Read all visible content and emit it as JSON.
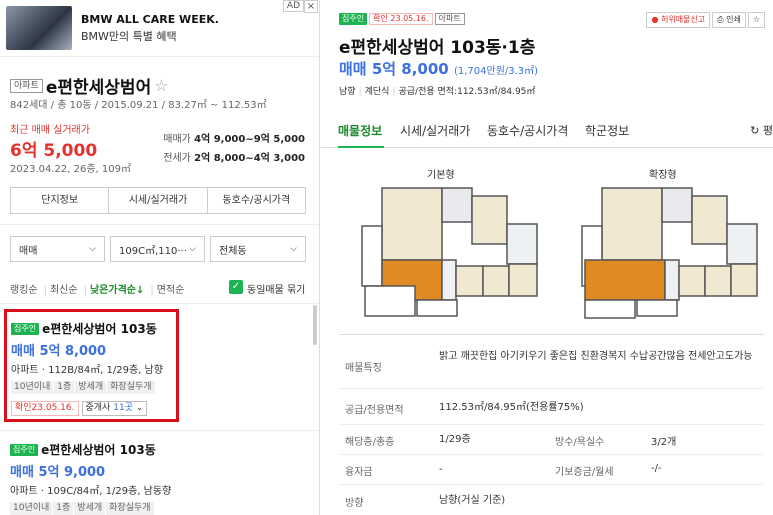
{
  "ad": {
    "title": "BMW ALL CARE WEEK.",
    "subtitle": "BMW만의 특별 혜택",
    "ad_tag": "AD",
    "close": "×"
  },
  "complex": {
    "type_tag": "아파트",
    "name": "e편한세상범어",
    "star": "☆",
    "info": "842세대 / 총 10동 / 2015.09.21 / 83.27㎡ ~ 112.53㎡"
  },
  "recent": {
    "label": "최근 매매 실거래가",
    "price": "6억 5,000",
    "date": "2023.04.22, 26층, 109㎡"
  },
  "price_table": [
    {
      "label": "매매가",
      "value": "4억 9,000~9억 5,000"
    },
    {
      "label": "전세가",
      "value": "2억 8,000~4억 3,000"
    }
  ],
  "left_tabs": [
    "단지정보",
    "시세/실거래가",
    "동호수/공시가격"
  ],
  "filters": [
    "매매",
    "109C㎡,110···",
    "전체동"
  ],
  "sort": {
    "items": [
      "랭킹순",
      "최신순",
      "낮은가격순↓",
      "면적순"
    ],
    "active_index": 2,
    "same_listing": "동일매물 묶기"
  },
  "listings": [
    {
      "badge": "집주인",
      "name": "e편한세상범어 103동",
      "price": "매매 5억 8,000",
      "desc": "아파트 · 112B/84㎡, 1/29층, 남향",
      "tags": [
        "10년이내",
        "1층",
        "방세개",
        "화장실두개"
      ],
      "confirm": "확인23.05.16.",
      "agent_label": "중개사",
      "agent_count": "11곳",
      "agent_chev": "⌄"
    },
    {
      "badge": "집주인",
      "name": "e편한세상범어 103동",
      "price": "매매 5억 9,000",
      "desc": "아파트 · 109C/84㎡, 1/29층, 남동향",
      "tags": [
        "10년이내",
        "1층",
        "방세개",
        "화장실두개"
      ]
    }
  ],
  "detail": {
    "badges": {
      "owner": "집주인",
      "confirm": "확인 23.05.16.",
      "type": "아파트"
    },
    "tools": [
      "허위매물신고",
      "인쇄",
      "☆"
    ],
    "title": "e편한세상범어 103동·1층",
    "price": "매매 5억 8,000",
    "price_per": "(1,704만원/3.3㎡)",
    "info": [
      "남향",
      "계단식",
      "공급/전용 면적:112.53㎡/84.95㎡"
    ],
    "tabs": [
      "매물정보",
      "시세/실거래가",
      "동호수/공시가격",
      "학군정보"
    ],
    "refresh": "↻ 평",
    "plan_labels": [
      "기본형",
      "확장형"
    ],
    "rows": [
      {
        "th": "매물특징",
        "td": "밝고 깨끗한집 아기키우기 좋은집 친환경복지 수납공간많음 전세안고도가능"
      },
      {
        "th": "공급/전용면적",
        "td": "112.53㎡/84.95㎡(전용률75%)"
      },
      {
        "th": "해당층/총층",
        "td": "1/29층",
        "th2": "방수/욕실수",
        "td2": "3/2개"
      },
      {
        "th": "융자금",
        "td": "-",
        "th2": "기보증금/월세",
        "td2": "-/-"
      },
      {
        "th": "방향",
        "td": "남향(거실 기준)"
      }
    ]
  },
  "colors": {
    "green": "#1db350",
    "blue": "#3b6fe2",
    "red": "#e5322d",
    "highlight": "#d80f1a"
  }
}
